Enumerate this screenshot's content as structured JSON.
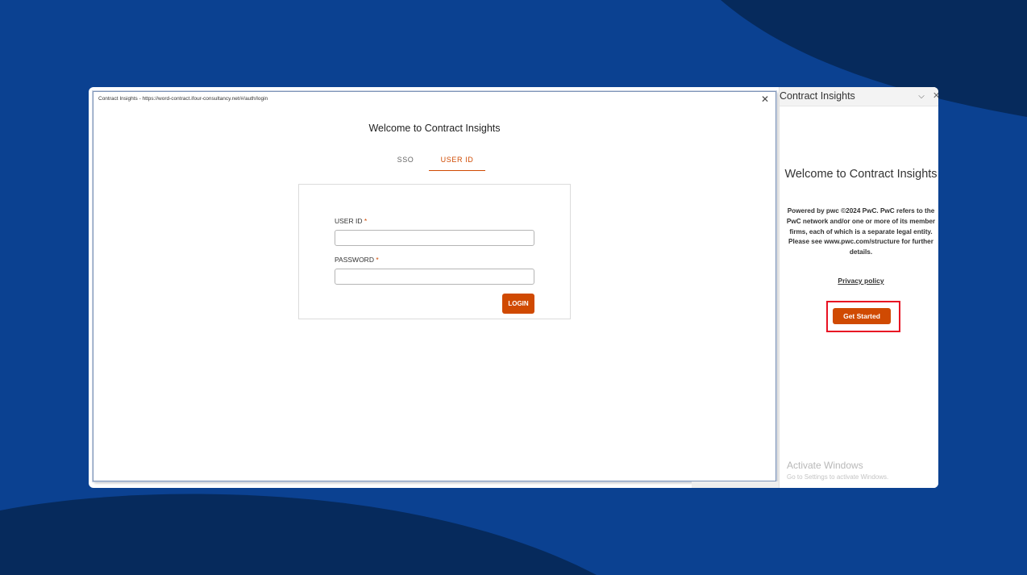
{
  "colors": {
    "background": "#0b4191",
    "background_dark": "#062a5c",
    "accent": "#d04a02",
    "highlight": "#e81123"
  },
  "dialog": {
    "title": "Contract Insights - https://word-contract.ifour-consultancy.net/#/auth/login",
    "close_icon": "close-icon",
    "close_glyph": "✕",
    "welcome": "Welcome to Contract Insights",
    "tabs": [
      {
        "label": "SSO",
        "active": false
      },
      {
        "label": "USER ID",
        "active": true
      }
    ],
    "form": {
      "user_id_label": "USER ID",
      "password_label": "PASSWORD",
      "required_mark": "*",
      "user_id_value": "",
      "password_value": "",
      "login_label": "LOGIN"
    }
  },
  "taskpane": {
    "title": "Contract Insights",
    "chevron_glyph": "⌵",
    "close_glyph": "✕",
    "welcome": "Welcome to Contract Insights",
    "powered_text": "Powered by pwc ©2024 PwC. PwC refers to the PwC network and/or one or more of its member firms, each of which is a separate legal entity. Please see www.pwc.com/structure for further details.",
    "privacy_label": "Privacy policy",
    "get_started_label": "Get Started"
  },
  "watermark": {
    "title": "Activate Windows",
    "subtitle": "Go to Settings to activate Windows."
  }
}
